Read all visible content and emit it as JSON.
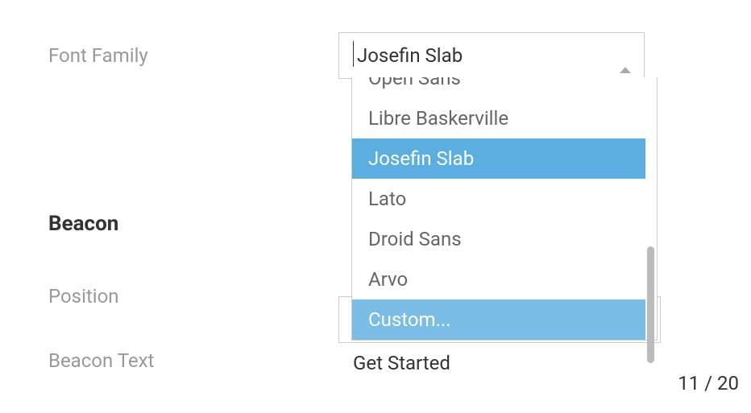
{
  "labels": {
    "font_family": "Font Family",
    "beacon": "Beacon",
    "position": "Position",
    "beacon_text": "Beacon Text"
  },
  "font_select": {
    "value": "Josefin Slab",
    "options": [
      {
        "label": "Open Sans",
        "state": "partial"
      },
      {
        "label": "Libre Baskerville",
        "state": "normal"
      },
      {
        "label": "Josefin Slab",
        "state": "selected"
      },
      {
        "label": "Lato",
        "state": "normal"
      },
      {
        "label": "Droid Sans",
        "state": "normal"
      },
      {
        "label": "Arvo",
        "state": "normal"
      },
      {
        "label": "Custom...",
        "state": "highlighted"
      }
    ]
  },
  "beacon_text": {
    "hidden_value": "Get Started",
    "counter": "11 / 20"
  }
}
